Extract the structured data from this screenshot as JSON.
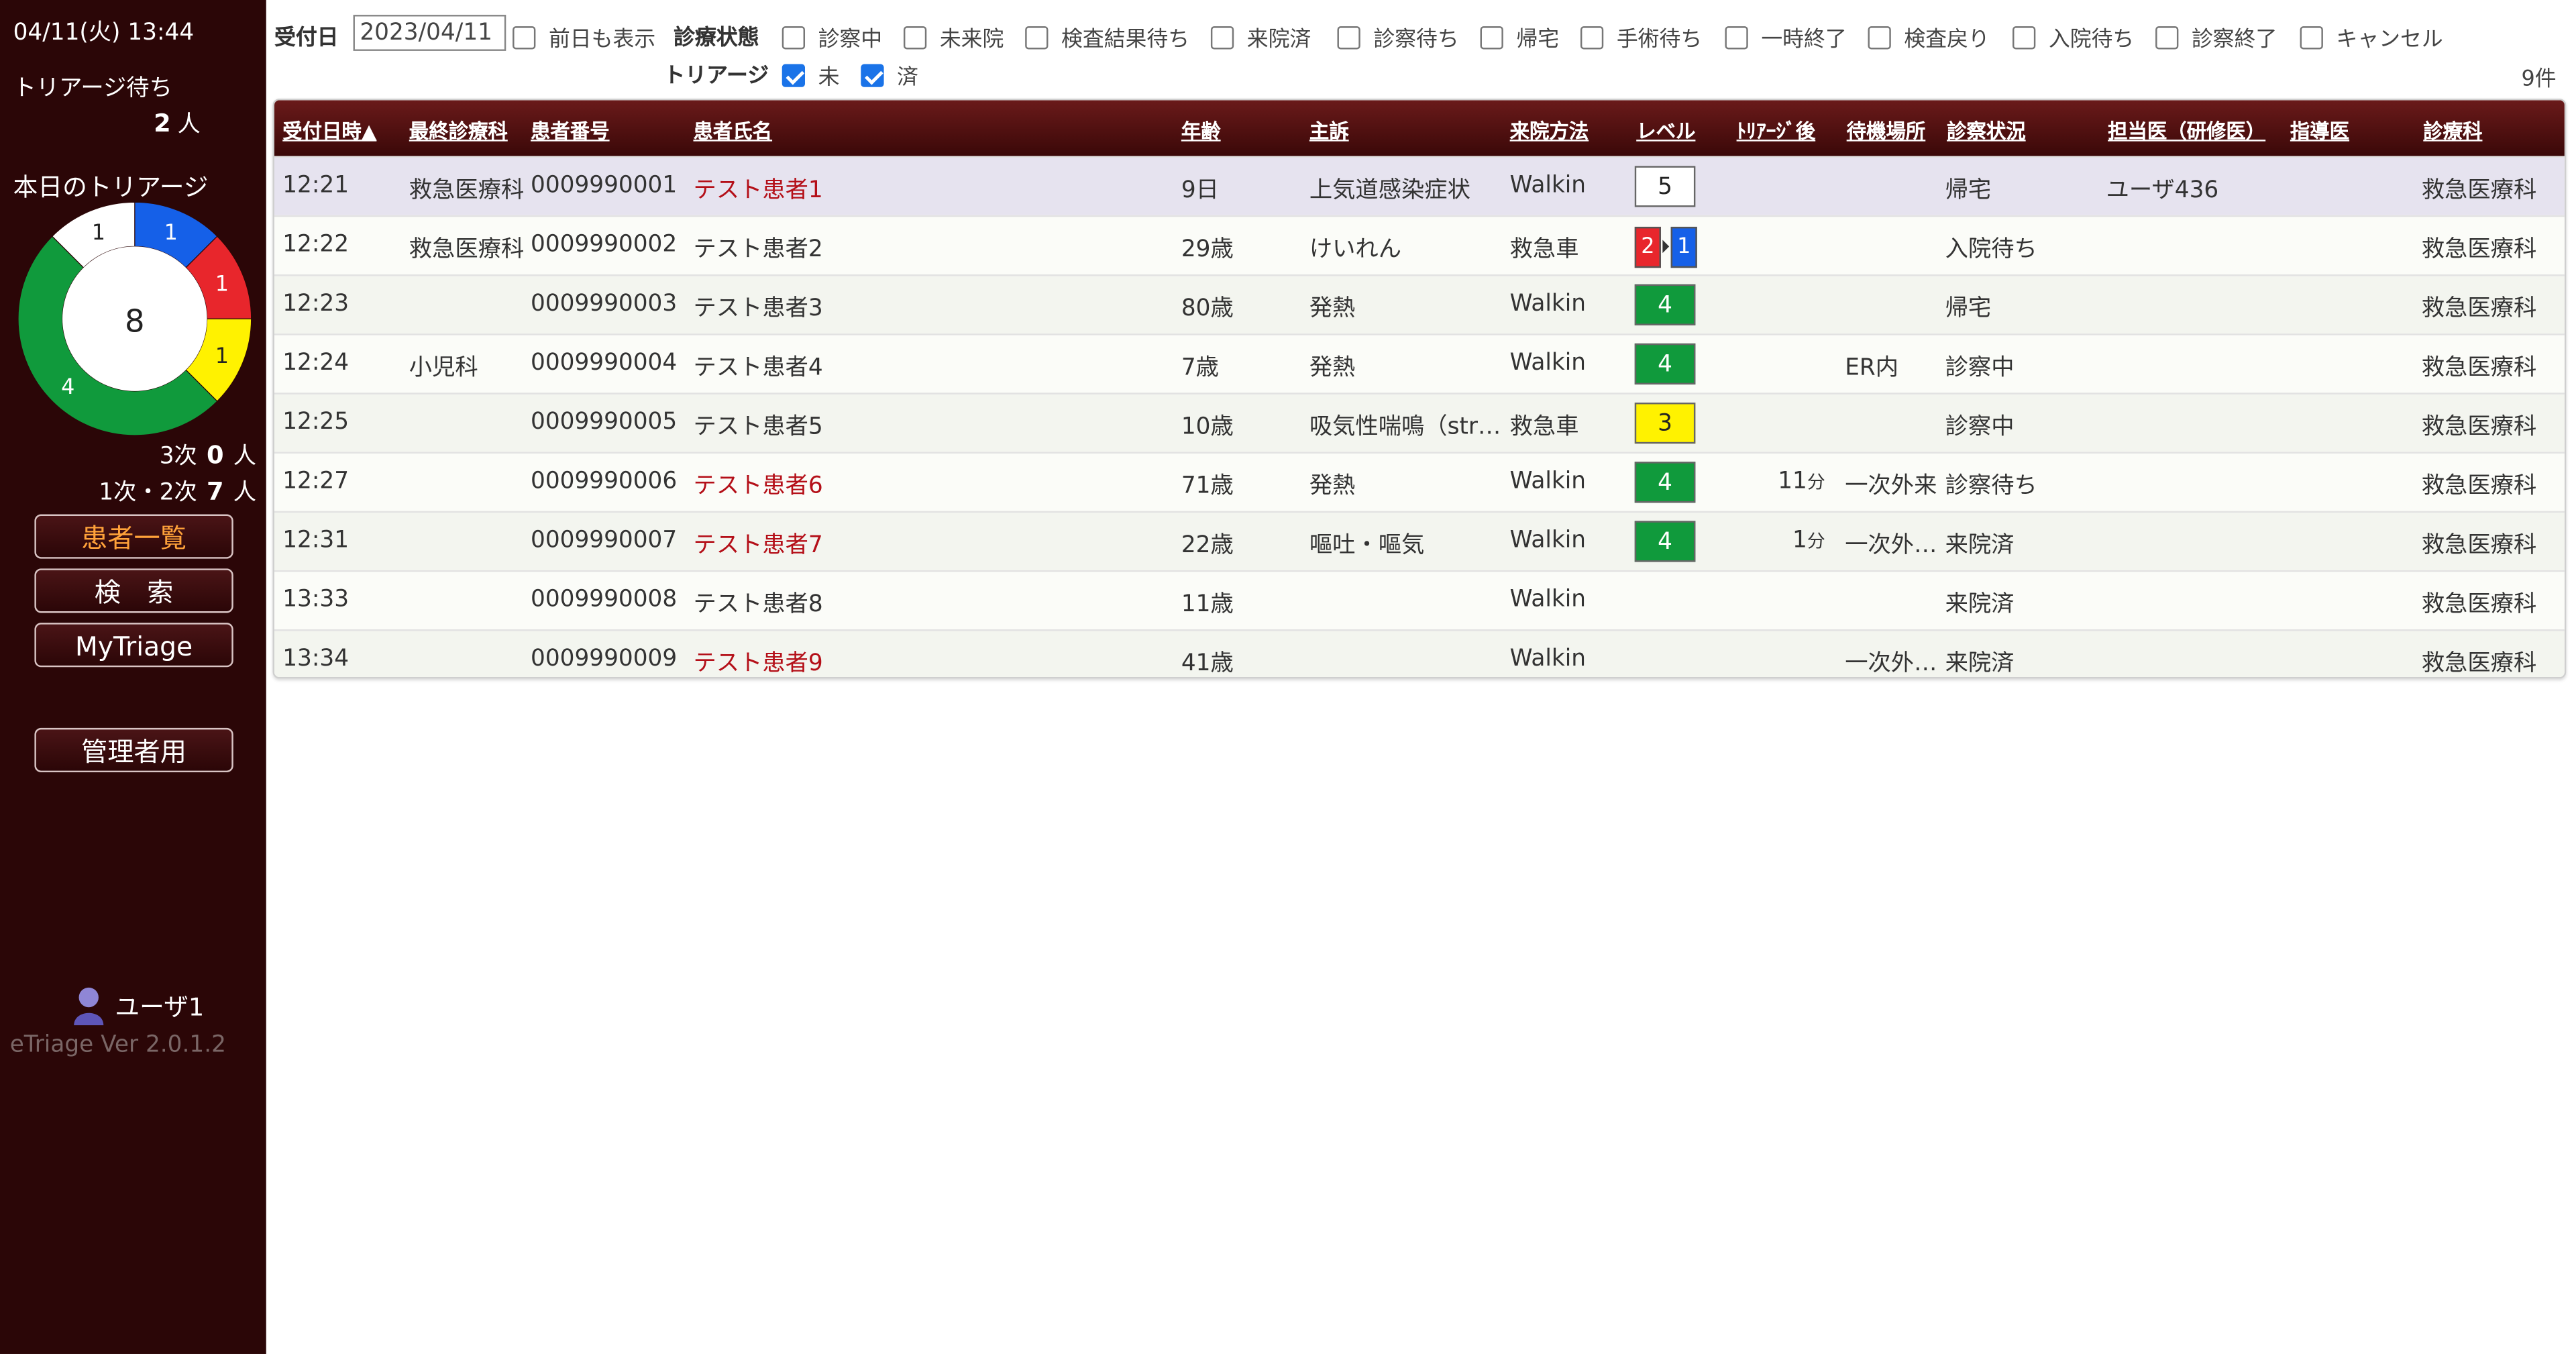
{
  "sidebar": {
    "datetime": "04/11(火) 13:44",
    "waiting_label": "トリアージ待ち",
    "waiting_count": "2",
    "unit": "人",
    "today_label": "本日のトリアージ",
    "donut": {
      "total": "8",
      "segments": [
        {
          "level": 1,
          "value": 1,
          "color": "#1560e8"
        },
        {
          "level": 2,
          "value": 1,
          "color": "#e8262c"
        },
        {
          "level": 3,
          "value": 1,
          "color": "#fff200"
        },
        {
          "level": 4,
          "value": 4,
          "color": "#109a3c"
        },
        {
          "level": 5,
          "value": 1,
          "color": "#ffffff"
        }
      ],
      "labels": [
        "1",
        "1",
        "1",
        "4",
        "1"
      ]
    },
    "stat_tertiary_label": "3次",
    "stat_tertiary_value": "0",
    "stat_primary_label": "1次・2次",
    "stat_primary_value": "7",
    "buttons": {
      "patient_list": "患者一覧",
      "search": "検　索",
      "mytriage": "MyTriage",
      "admin": "管理者用"
    },
    "user": "ユーザ1",
    "version": "eTriage Ver 2.0.1.2"
  },
  "filters": {
    "reception_label": "受付日",
    "reception_date": "2023/04/11",
    "prev_day_label": "前日も表示",
    "status_label": "診療状態",
    "statuses": [
      "診察中",
      "未来院",
      "検査結果待ち",
      "来院済",
      "診察待ち",
      "帰宅",
      "手術待ち",
      "一時終了",
      "検査戻り",
      "入院待ち",
      "診察終了",
      "キャンセル"
    ],
    "triage_label": "トリアージ",
    "triage_options": [
      "未",
      "済"
    ],
    "count": "9件"
  },
  "table": {
    "headers": [
      "受付日時▲",
      "最終診療科",
      "患者番号",
      "患者氏名",
      "年齢",
      "主訴",
      "来院方法",
      "レベル",
      "ﾄﾘｱｰｼﾞ後",
      "待機場所",
      "診察状況",
      "担当医（研修医）",
      "指導医",
      "診療科"
    ],
    "rows": [
      {
        "time": "12:21",
        "last_dept": "救急医療科",
        "id": "0009990001",
        "name": "テスト患者1",
        "age": "9日",
        "complaint": "上気道感染症状",
        "arrival": "Walkin",
        "level": "5",
        "after": "",
        "place": "",
        "status": "帰宅",
        "doctor": "ユーザ436",
        "supervisor": "",
        "dept": "救急医療科"
      },
      {
        "time": "12:22",
        "last_dept": "救急医療科",
        "id": "0009990002",
        "name": "テスト患者2",
        "age": "29歳",
        "complaint": "けいれん",
        "arrival": "救急車",
        "level": "2→1",
        "level_from": "2",
        "level_to": "1",
        "after": "",
        "place": "",
        "status": "入院待ち",
        "doctor": "",
        "supervisor": "",
        "dept": "救急医療科"
      },
      {
        "time": "12:23",
        "last_dept": "",
        "id": "0009990003",
        "name": "テスト患者3",
        "age": "80歳",
        "complaint": "発熱",
        "arrival": "Walkin",
        "level": "4",
        "after": "",
        "place": "",
        "status": "帰宅",
        "doctor": "",
        "supervisor": "",
        "dept": "救急医療科"
      },
      {
        "time": "12:24",
        "last_dept": "小児科",
        "id": "0009990004",
        "name": "テスト患者4",
        "age": "7歳",
        "complaint": "発熱",
        "arrival": "Walkin",
        "level": "4",
        "after": "",
        "place": "ER内",
        "status": "診察中",
        "doctor": "",
        "supervisor": "",
        "dept": "救急医療科"
      },
      {
        "time": "12:25",
        "last_dept": "",
        "id": "0009990005",
        "name": "テスト患者5",
        "age": "10歳",
        "complaint": "吸気性喘鳴（str…",
        "arrival": "救急車",
        "level": "3",
        "after": "",
        "place": "",
        "status": "診察中",
        "doctor": "",
        "supervisor": "",
        "dept": "救急医療科"
      },
      {
        "time": "12:27",
        "last_dept": "",
        "id": "0009990006",
        "name": "テスト患者6",
        "age": "71歳",
        "complaint": "発熱",
        "arrival": "Walkin",
        "level": "4",
        "after_num": "11",
        "after_unit": "分",
        "place": "一次外来",
        "status": "診察待ち",
        "doctor": "",
        "supervisor": "",
        "dept": "救急医療科"
      },
      {
        "time": "12:31",
        "last_dept": "",
        "id": "0009990007",
        "name": "テスト患者7",
        "age": "22歳",
        "complaint": "嘔吐・嘔気",
        "arrival": "Walkin",
        "level": "4",
        "after_num": "1",
        "after_unit": "分",
        "place": "一次外…",
        "status": "来院済",
        "doctor": "",
        "supervisor": "",
        "dept": "救急医療科"
      },
      {
        "time": "13:33",
        "last_dept": "",
        "id": "0009990008",
        "name": "テスト患者8",
        "age": "11歳",
        "complaint": "",
        "arrival": "Walkin",
        "level": "",
        "after": "",
        "place": "",
        "status": "来院済",
        "doctor": "",
        "supervisor": "",
        "dept": "救急医療科"
      },
      {
        "time": "13:34",
        "last_dept": "",
        "id": "0009990009",
        "name": "テスト患者9",
        "age": "41歳",
        "complaint": "",
        "arrival": "Walkin",
        "level": "",
        "after": "",
        "place": "一次外…",
        "status": "来院済",
        "doctor": "",
        "supervisor": "",
        "dept": "救急医療科"
      }
    ]
  },
  "level_colors": {
    "1": "#1560e8",
    "2": "#e8262c",
    "3": "#fff200",
    "4": "#109a3c",
    "5": "#ffffff"
  }
}
